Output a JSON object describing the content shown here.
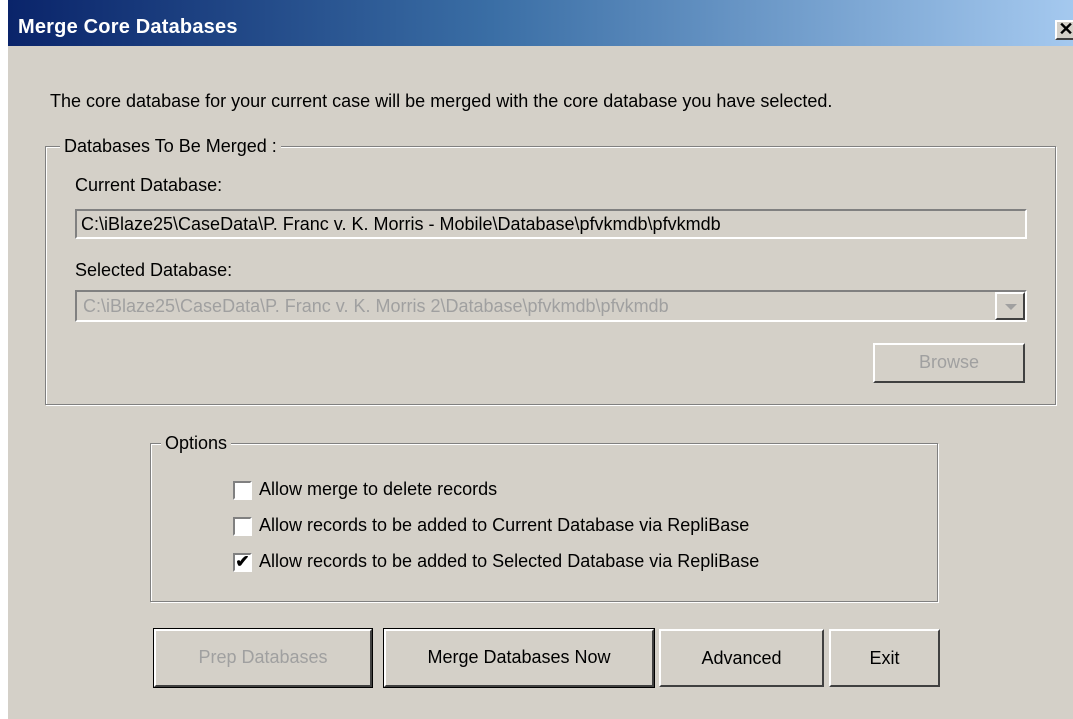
{
  "window": {
    "title": "Merge Core Databases",
    "close_glyph": "✕"
  },
  "intro_text": "The core database for your current case will be merged with the core database you have selected.",
  "databases_group": {
    "label": "Databases To Be Merged :",
    "current_label": "Current Database:",
    "current_value": "C:\\iBlaze25\\CaseData\\P. Franc v. K. Morris - Mobile\\Database\\pfvkmdb\\pfvkmdb",
    "selected_label": "Selected Database:",
    "selected_value": "C:\\iBlaze25\\CaseData\\P. Franc v. K. Morris 2\\Database\\pfvkmdb\\pfvkmdb",
    "browse_label": "Browse"
  },
  "options_group": {
    "label": "Options",
    "items": [
      {
        "label": "Allow merge to delete records",
        "checked": false
      },
      {
        "label": "Allow records to be added to Current Database via RepliBase",
        "checked": false
      },
      {
        "label": "Allow records to be added to Selected Database via RepliBase",
        "checked": true
      }
    ],
    "check_glyph": "✔"
  },
  "buttons": {
    "prep": "Prep Databases",
    "merge_now": "Merge Databases Now",
    "advanced": "Advanced",
    "exit": "Exit"
  },
  "colors": {
    "face": "#d4d0c8",
    "title_start": "#0a246a",
    "title_end": "#a6caf0",
    "disabled_text": "#a0a0a0"
  }
}
